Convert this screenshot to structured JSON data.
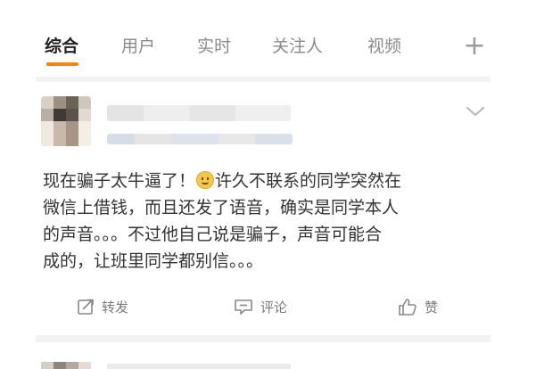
{
  "tabs": [
    {
      "label": "综合"
    },
    {
      "label": "用户"
    },
    {
      "label": "实时"
    },
    {
      "label": "关注人"
    },
    {
      "label": "视频"
    }
  ],
  "add_tab_symbol": "+",
  "post": {
    "lines": [
      "现在骗子太牛逼了！",
      "许久不联系的同学突然在",
      "微信上借钱，而且还发了语音，确实是同学本人",
      "的声音。。。不过他自己说是骗子，声音可能合",
      "成的，让班里同学都别信。。。"
    ],
    "emoji_icon": "smile-emoji-icon",
    "actions": {
      "repost_label": "转发",
      "comment_label": "评论",
      "like_label": "赞"
    }
  },
  "colors": {
    "accent": "#ff8200",
    "text": "#333333",
    "muted": "#8a8a8a",
    "divider": "#f2f2f2"
  }
}
